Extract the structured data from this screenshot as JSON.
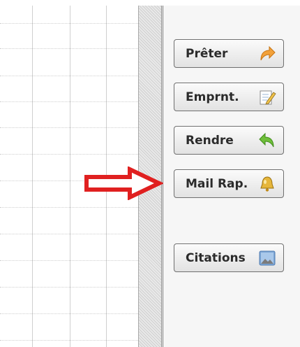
{
  "buttons": {
    "preter": {
      "label": "Prêter",
      "icon": "orange-curved-arrow-icon"
    },
    "emprunt": {
      "label": "Emprnt.",
      "icon": "notepad-pencil-icon"
    },
    "rendre": {
      "label": "Rendre",
      "icon": "green-return-arrow-icon"
    },
    "mail_rap": {
      "label": "Mail Rap.",
      "icon": "bell-icon"
    },
    "citations": {
      "label": "Citations",
      "icon": "picture-icon"
    }
  },
  "colors": {
    "annotation_arrow": "#e02020",
    "button_text": "#2b2b2b",
    "panel_bg": "#f6f6f6"
  }
}
